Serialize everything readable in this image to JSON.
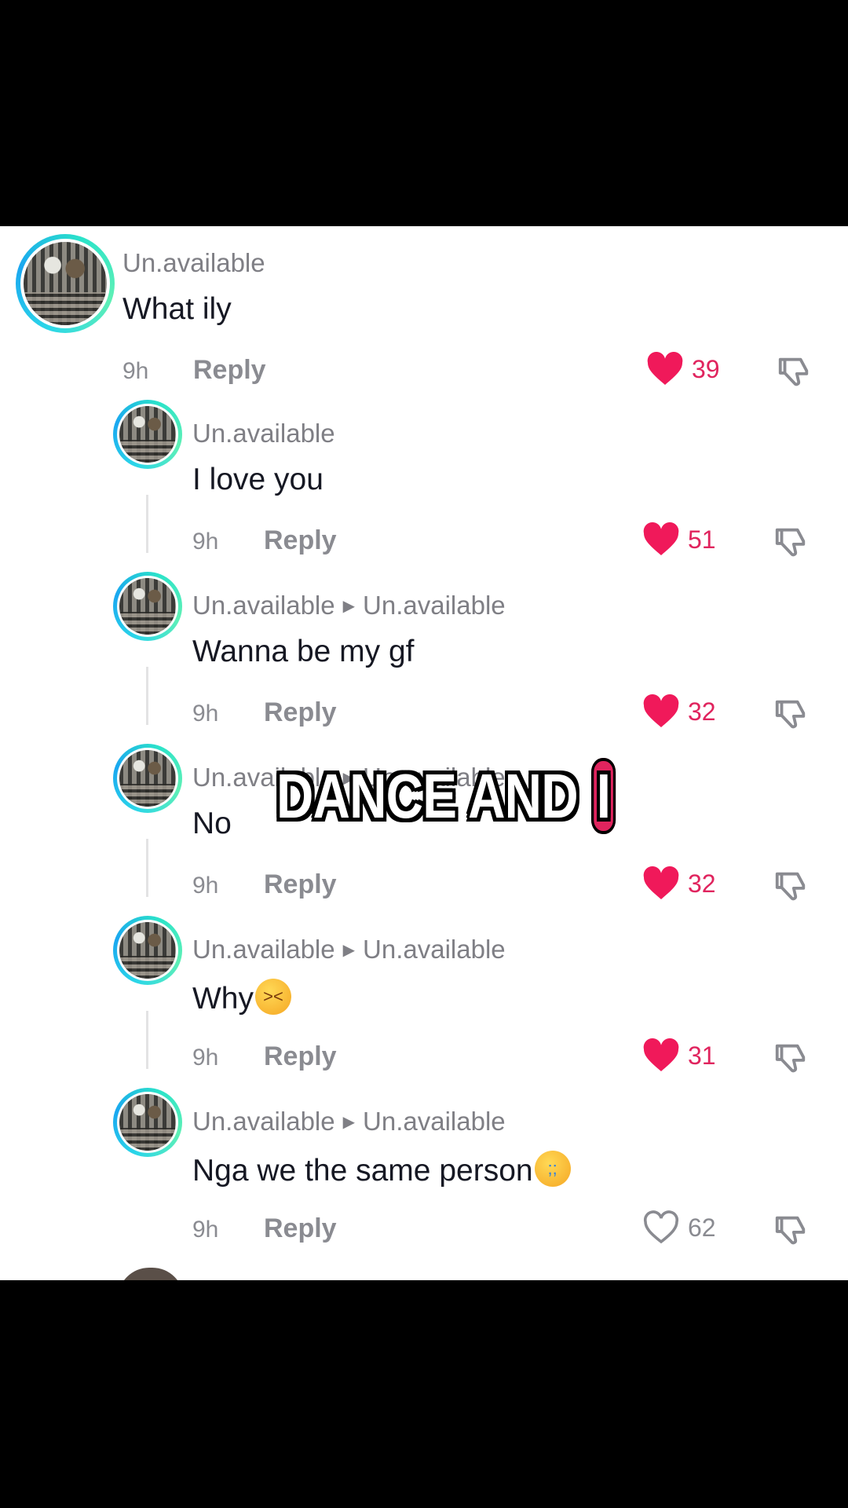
{
  "colors": {
    "accent_like": "#e0245e",
    "avatar_ring": "#2bd6e8",
    "panel_bg": "#ffffff"
  },
  "comments": [
    {
      "username": "Un.available",
      "reply_to": "",
      "text": "What ily",
      "time": "9h",
      "reply_label": "Reply",
      "likes": "39",
      "liked": true
    },
    {
      "username": "Un.available",
      "reply_to": "",
      "text": "I love you",
      "time": "9h",
      "reply_label": "Reply",
      "likes": "51",
      "liked": true
    },
    {
      "username": "Un.available",
      "reply_to": "Un.available",
      "text": "Wanna be my gf",
      "time": "9h",
      "reply_label": "Reply",
      "likes": "32",
      "liked": true
    },
    {
      "username": "Un.available",
      "reply_to": "Un.available",
      "text": "No",
      "time": "9h",
      "reply_label": "Reply",
      "likes": "32",
      "liked": true
    },
    {
      "username": "Un.available",
      "reply_to": "Un.available",
      "text": "Why",
      "emoji": "persevering-face-emoji",
      "time": "9h",
      "reply_label": "Reply",
      "likes": "31",
      "liked": true
    },
    {
      "username": "Un.available",
      "reply_to": "Un.available",
      "text": "Nga we the same person",
      "emoji": "loudly-crying-face-emoji",
      "time": "9h",
      "reply_label": "Reply",
      "likes": "62",
      "liked": false
    }
  ],
  "caption": {
    "main": "DANCE AND ",
    "highlight": "I"
  },
  "icons": {
    "like": "heart-icon",
    "dislike": "thumbs-down-icon",
    "reply_arrow": "triangle-right-icon"
  }
}
